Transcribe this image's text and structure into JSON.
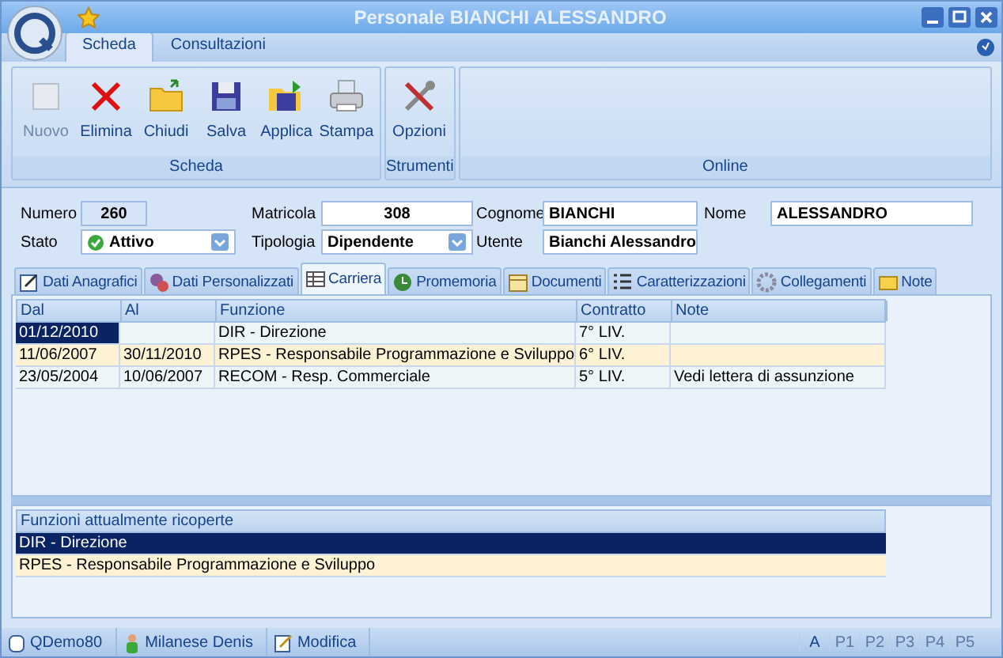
{
  "window": {
    "title": "Personale BIANCHI ALESSANDRO"
  },
  "ribbon_tabs": [
    {
      "label": "Scheda",
      "selected": true
    },
    {
      "label": "Consultazioni",
      "selected": false
    }
  ],
  "ribbon_groups": [
    {
      "label": "Scheda",
      "buttons": [
        {
          "label": "Nuovo",
          "kind": "new",
          "disabled": true
        },
        {
          "label": "Elimina",
          "kind": "delete",
          "disabled": false
        },
        {
          "label": "Chiudi",
          "kind": "close",
          "disabled": false
        },
        {
          "label": "Salva",
          "kind": "save",
          "disabled": false
        },
        {
          "label": "Applica",
          "kind": "apply",
          "disabled": false
        },
        {
          "label": "Stampa",
          "kind": "print",
          "disabled": false
        }
      ]
    },
    {
      "label": "Strumenti",
      "buttons": [
        {
          "label": "Opzioni",
          "kind": "options",
          "disabled": false
        }
      ]
    },
    {
      "label": "Online"
    }
  ],
  "form": {
    "numero_label": "Numero",
    "numero": "260",
    "matricola_label": "Matricola",
    "matricola": "308",
    "cognome_label": "Cognome",
    "cognome": "BIANCHI",
    "nome_label": "Nome",
    "nome": "ALESSANDRO",
    "stato_label": "Stato",
    "stato": "Attivo",
    "tipologia_label": "Tipologia",
    "tipologia": "Dipendente",
    "utente_label": "Utente",
    "utente": "Bianchi Alessandro"
  },
  "tabs": [
    {
      "label": "Dati Anagrafici",
      "kind": "edit",
      "selected": false
    },
    {
      "label": "Dati Personalizzati",
      "kind": "gears",
      "selected": false
    },
    {
      "label": "Carriera",
      "kind": "table",
      "selected": true
    },
    {
      "label": "Promemoria",
      "kind": "clock",
      "selected": false
    },
    {
      "label": "Documenti",
      "kind": "calendar",
      "selected": false
    },
    {
      "label": "Caratterizzazioni",
      "kind": "list",
      "selected": false
    },
    {
      "label": "Collegamenti",
      "kind": "gear",
      "selected": false
    },
    {
      "label": "Note",
      "kind": "note",
      "selected": false
    }
  ],
  "career_table": {
    "columns": [
      "Dal",
      "Al",
      "Funzione",
      "Contratto",
      "Note"
    ],
    "rows": [
      {
        "cells": [
          "01/12/2010",
          "",
          "DIR - Direzione",
          "7° LIV.",
          ""
        ],
        "selected": true
      },
      {
        "cells": [
          "11/06/2007",
          "30/11/2010",
          "RPES - Responsabile Programmazione e Sviluppo",
          "6° LIV.",
          ""
        ],
        "selected": false
      },
      {
        "cells": [
          "23/05/2004",
          "10/06/2007",
          "RECOM - Resp. Commerciale",
          "5° LIV.",
          "Vedi lettera di assunzione"
        ],
        "selected": false
      }
    ]
  },
  "functions_table": {
    "column": "Funzioni attualmente ricoperte",
    "rows": [
      {
        "text": "DIR - Direzione",
        "selected": true
      },
      {
        "text": "RPES - Responsabile Programmazione e Sviluppo",
        "selected": false
      }
    ]
  },
  "status_bar": {
    "database": "QDemo80",
    "user": "Milanese Denis",
    "mode": "Modifica",
    "indicators": [
      {
        "label": "A",
        "on": true
      },
      {
        "label": "P1",
        "on": false
      },
      {
        "label": "P2",
        "on": false
      },
      {
        "label": "P3",
        "on": false
      },
      {
        "label": "P4",
        "on": false
      },
      {
        "label": "P5",
        "on": false
      }
    ]
  }
}
